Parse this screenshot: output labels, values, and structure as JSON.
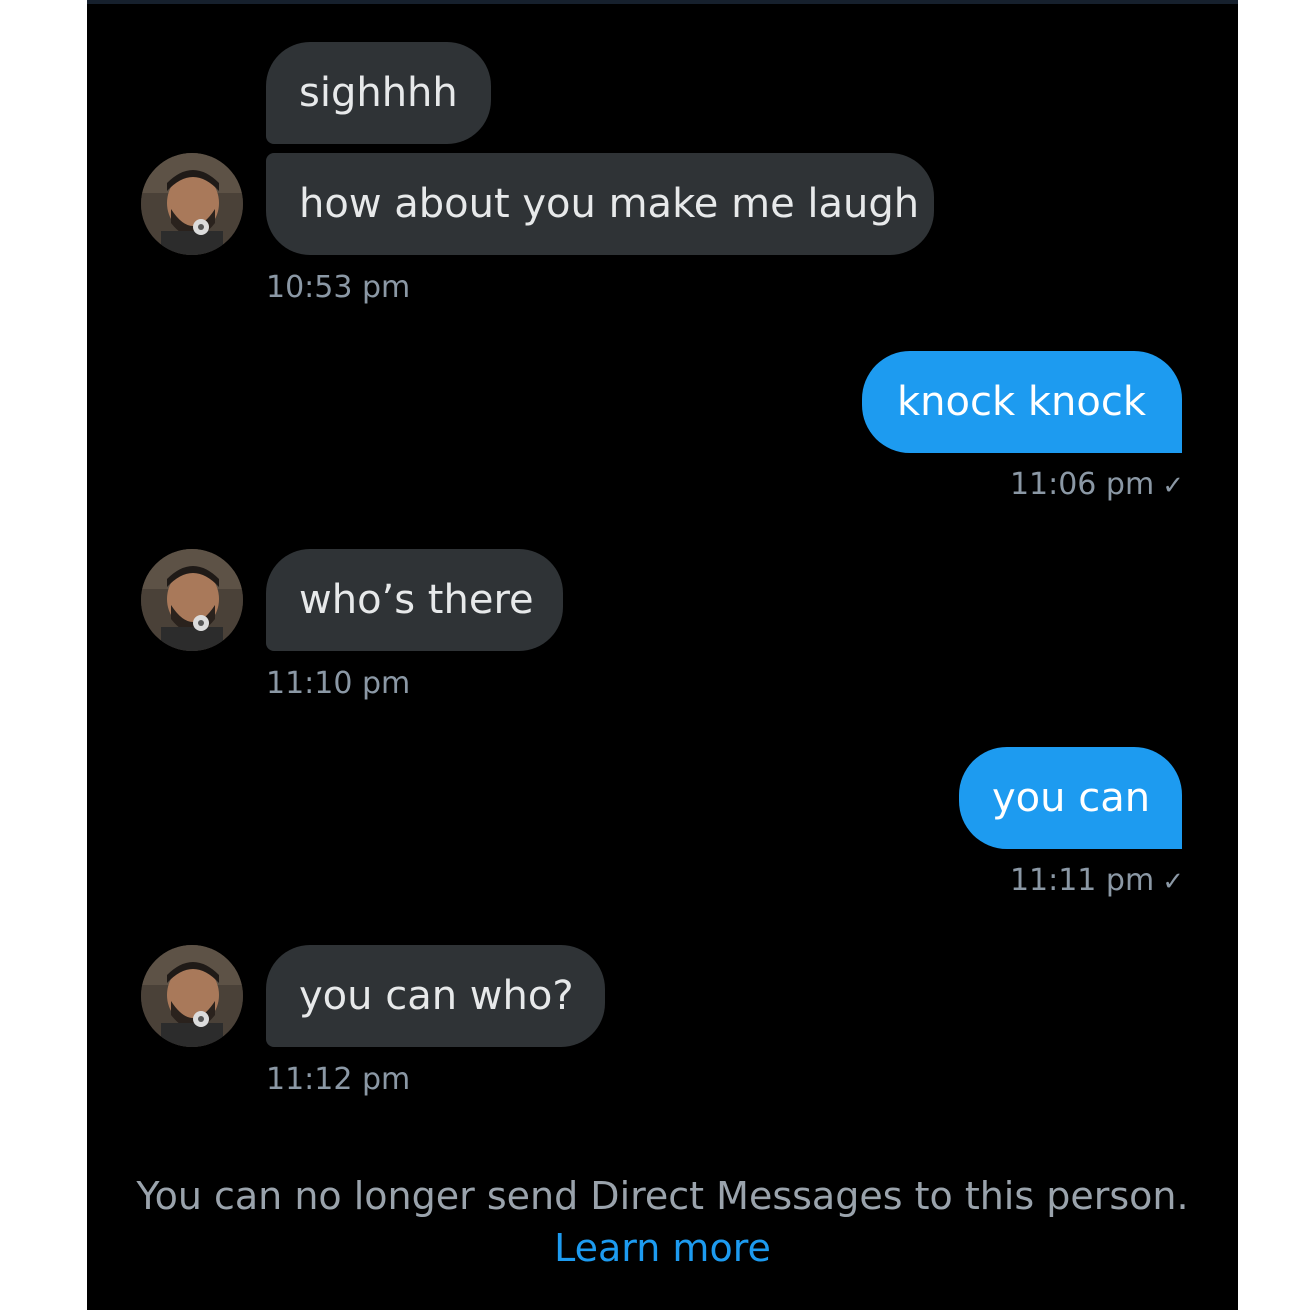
{
  "messages": [
    {
      "text": "sighhhh"
    },
    {
      "text": "how about you make me laugh",
      "time": "10:53 pm"
    },
    {
      "text": "knock knock",
      "time": "11:06 pm",
      "status": "✓"
    },
    {
      "text": "who’s there",
      "time": "11:10 pm"
    },
    {
      "text": "you can",
      "time": "11:11 pm",
      "status": "✓"
    },
    {
      "text": "you can who?",
      "time": "11:12 pm"
    }
  ],
  "footer": {
    "notice": "You can no longer send Direct Messages to this person.",
    "link": "Learn more"
  },
  "colors": {
    "background": "#000000",
    "incoming_bubble": "#2f3336",
    "outgoing_bubble": "#1d9bf0",
    "timestamp": "#8b98a5",
    "link": "#1d9bf0"
  },
  "icons": [
    "avatar-image",
    "read-check-icon"
  ]
}
